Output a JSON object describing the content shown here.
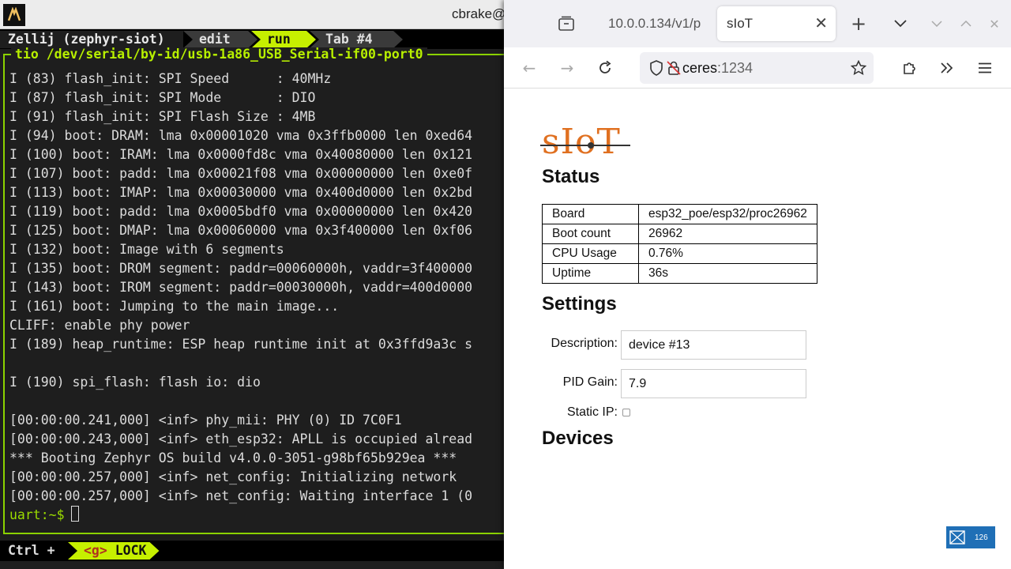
{
  "terminal": {
    "window_title": "cbrake@",
    "session": "Zellij (zephyr-siot)",
    "tabs": [
      "edit",
      "run",
      "Tab #4"
    ],
    "active_tab": "run",
    "pane_title": "tio /dev/serial/by-id/usb-1a86_USB_Serial-if00-port0",
    "lines": [
      "I (83) flash_init: SPI Speed      : 40MHz",
      "I (87) flash_init: SPI Mode       : DIO",
      "I (91) flash_init: SPI Flash Size : 4MB",
      "I (94) boot: DRAM: lma 0x00001020 vma 0x3ffb0000 len 0xed64",
      "I (100) boot: IRAM: lma 0x0000fd8c vma 0x40080000 len 0x121",
      "I (107) boot: padd: lma 0x00021f08 vma 0x00000000 len 0xe0f",
      "I (113) boot: IMAP: lma 0x00030000 vma 0x400d0000 len 0x2bd",
      "I (119) boot: padd: lma 0x0005bdf0 vma 0x00000000 len 0x420",
      "I (125) boot: DMAP: lma 0x00060000 vma 0x3f400000 len 0xf06",
      "I (132) boot: Image with 6 segments",
      "I (135) boot: DROM segment: paddr=00060000h, vaddr=3f400000",
      "I (143) boot: IROM segment: paddr=00030000h, vaddr=400d0000",
      "I (161) boot: Jumping to the main image...",
      "CLIFF: enable phy power",
      "I (189) heap_runtime: ESP heap runtime init at 0x3ffd9a3c s",
      "",
      "I (190) spi_flash: flash io: dio",
      "",
      "[00:00:00.241,000] <inf> phy_mii: PHY (0) ID 7C0F1",
      "[00:00:00.243,000] <inf> eth_esp32: APLL is occupied alread",
      "*** Booting Zephyr OS build v4.0.0-3051-g98bf65b929ea ***",
      "[00:00:00.257,000] <inf> net_config: Initializing network",
      "[00:00:00.257,000] <inf> net_config: Waiting interface 1 (0"
    ],
    "prompt": "uart:~$",
    "status_ctrl": "Ctrl +",
    "status_key": "<g>",
    "status_mode": "LOCK"
  },
  "browser": {
    "tabs": [
      {
        "label": "10.0.0.134/v1/p"
      },
      {
        "label": "sIoT"
      }
    ],
    "url_host": "ceres",
    "url_port": ":1234"
  },
  "page": {
    "logo": "sIoT",
    "status_heading": "Status",
    "status_rows": [
      {
        "key": "Board",
        "value": "esp32_poe/esp32/proc26962"
      },
      {
        "key": "Boot count",
        "value": "26962"
      },
      {
        "key": "CPU Usage",
        "value": "0.76%"
      },
      {
        "key": "Uptime",
        "value": "36s"
      }
    ],
    "settings_heading": "Settings",
    "description_label": "Description:",
    "description_value": "device #13",
    "pid_label": "PID Gain:",
    "pid_value": "7.9",
    "static_ip_label": "Static IP:",
    "static_ip_checked": false,
    "devices_heading": "Devices"
  },
  "tray": {
    "count": "126"
  }
}
